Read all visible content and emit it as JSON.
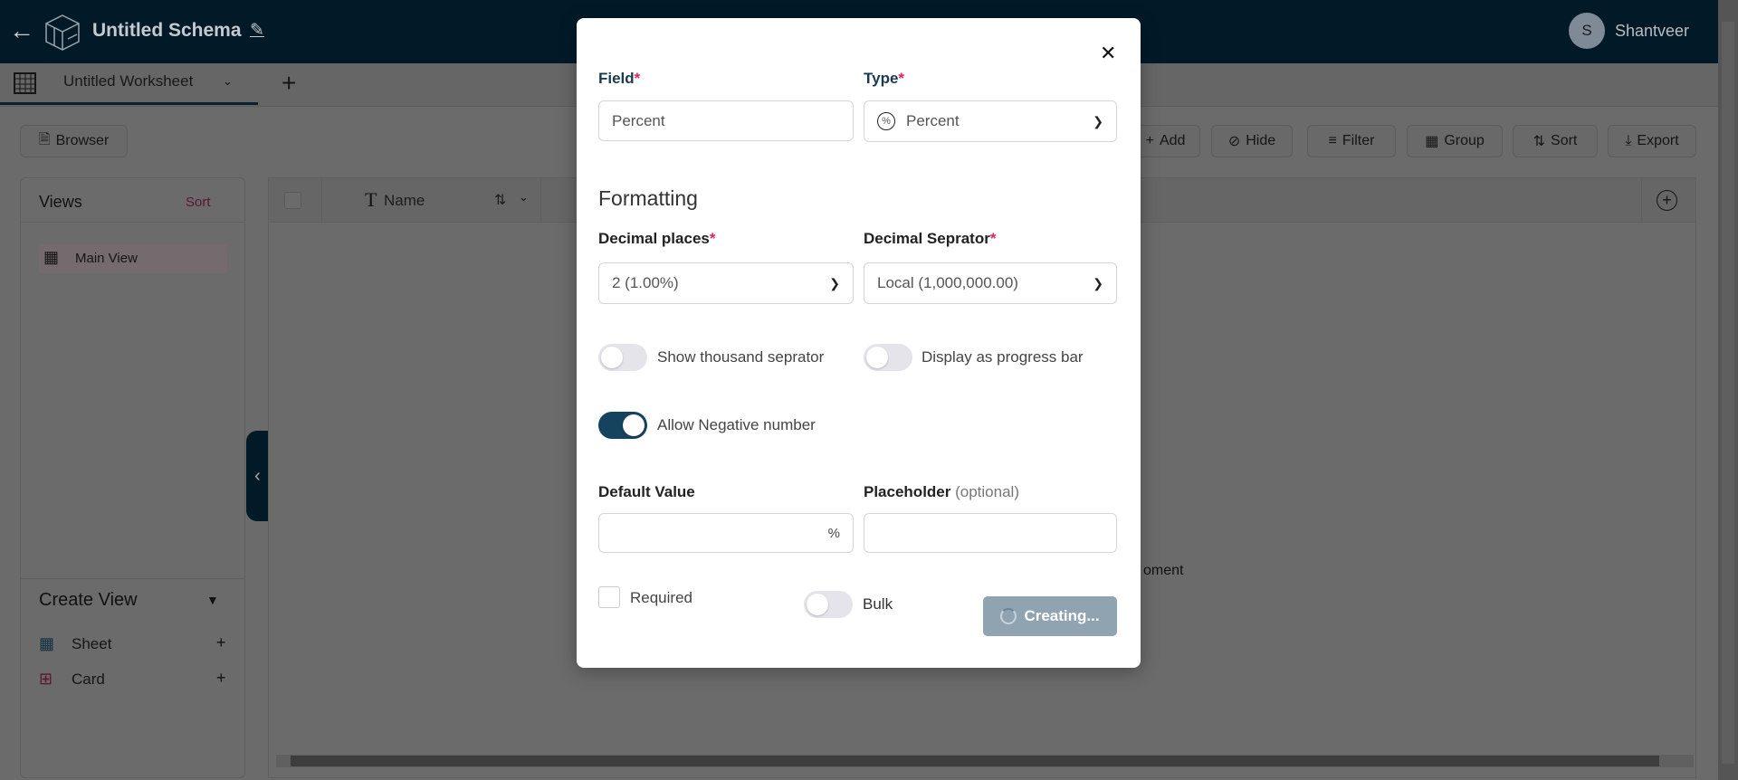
{
  "header": {
    "title": "Untitled Schema",
    "user_initial": "S",
    "user_name": "Shantveer"
  },
  "tabs": {
    "worksheet": "Untitled Worksheet"
  },
  "toolbar": {
    "browser": "Browser",
    "add": "Add",
    "hide": "Hide",
    "filter": "Filter",
    "group": "Group",
    "sort": "Sort",
    "export": "Export"
  },
  "views": {
    "title": "Views",
    "sort": "Sort",
    "items": [
      {
        "label": "Main View"
      }
    ]
  },
  "create_view": {
    "title": "Create View",
    "items": [
      {
        "label": "Sheet"
      },
      {
        "label": "Card"
      }
    ]
  },
  "table": {
    "columns": [
      {
        "label": "Name"
      }
    ],
    "background_text": "oment"
  },
  "modal": {
    "field_label": "Field",
    "field_value": "Percent",
    "type_label": "Type",
    "type_value": "Percent",
    "formatting": "Formatting",
    "decimal_places_label": "Decimal places",
    "decimal_places_value": "2 (1.00%)",
    "decimal_separator_label": "Decimal Seprator",
    "decimal_separator_value": "Local (1,000,000.00)",
    "show_thousand": {
      "label": "Show thousand seprator",
      "on": false
    },
    "progress_bar": {
      "label": "Display as progress bar",
      "on": false
    },
    "allow_negative": {
      "label": "Allow Negative number",
      "on": true
    },
    "default_value_label": "Default Value",
    "default_value": "",
    "percent_suffix": "%",
    "placeholder_label": "Placeholder",
    "placeholder_optional": "(optional)",
    "placeholder_value": "",
    "required_label": "Required",
    "required_checked": false,
    "bulk": {
      "label": "Bulk",
      "on": false
    },
    "submit_label": "Creating..."
  },
  "colors": {
    "header": "#053e60",
    "accent": "#15435f",
    "required": "#e0245e",
    "submit": "#8fa3b0"
  }
}
